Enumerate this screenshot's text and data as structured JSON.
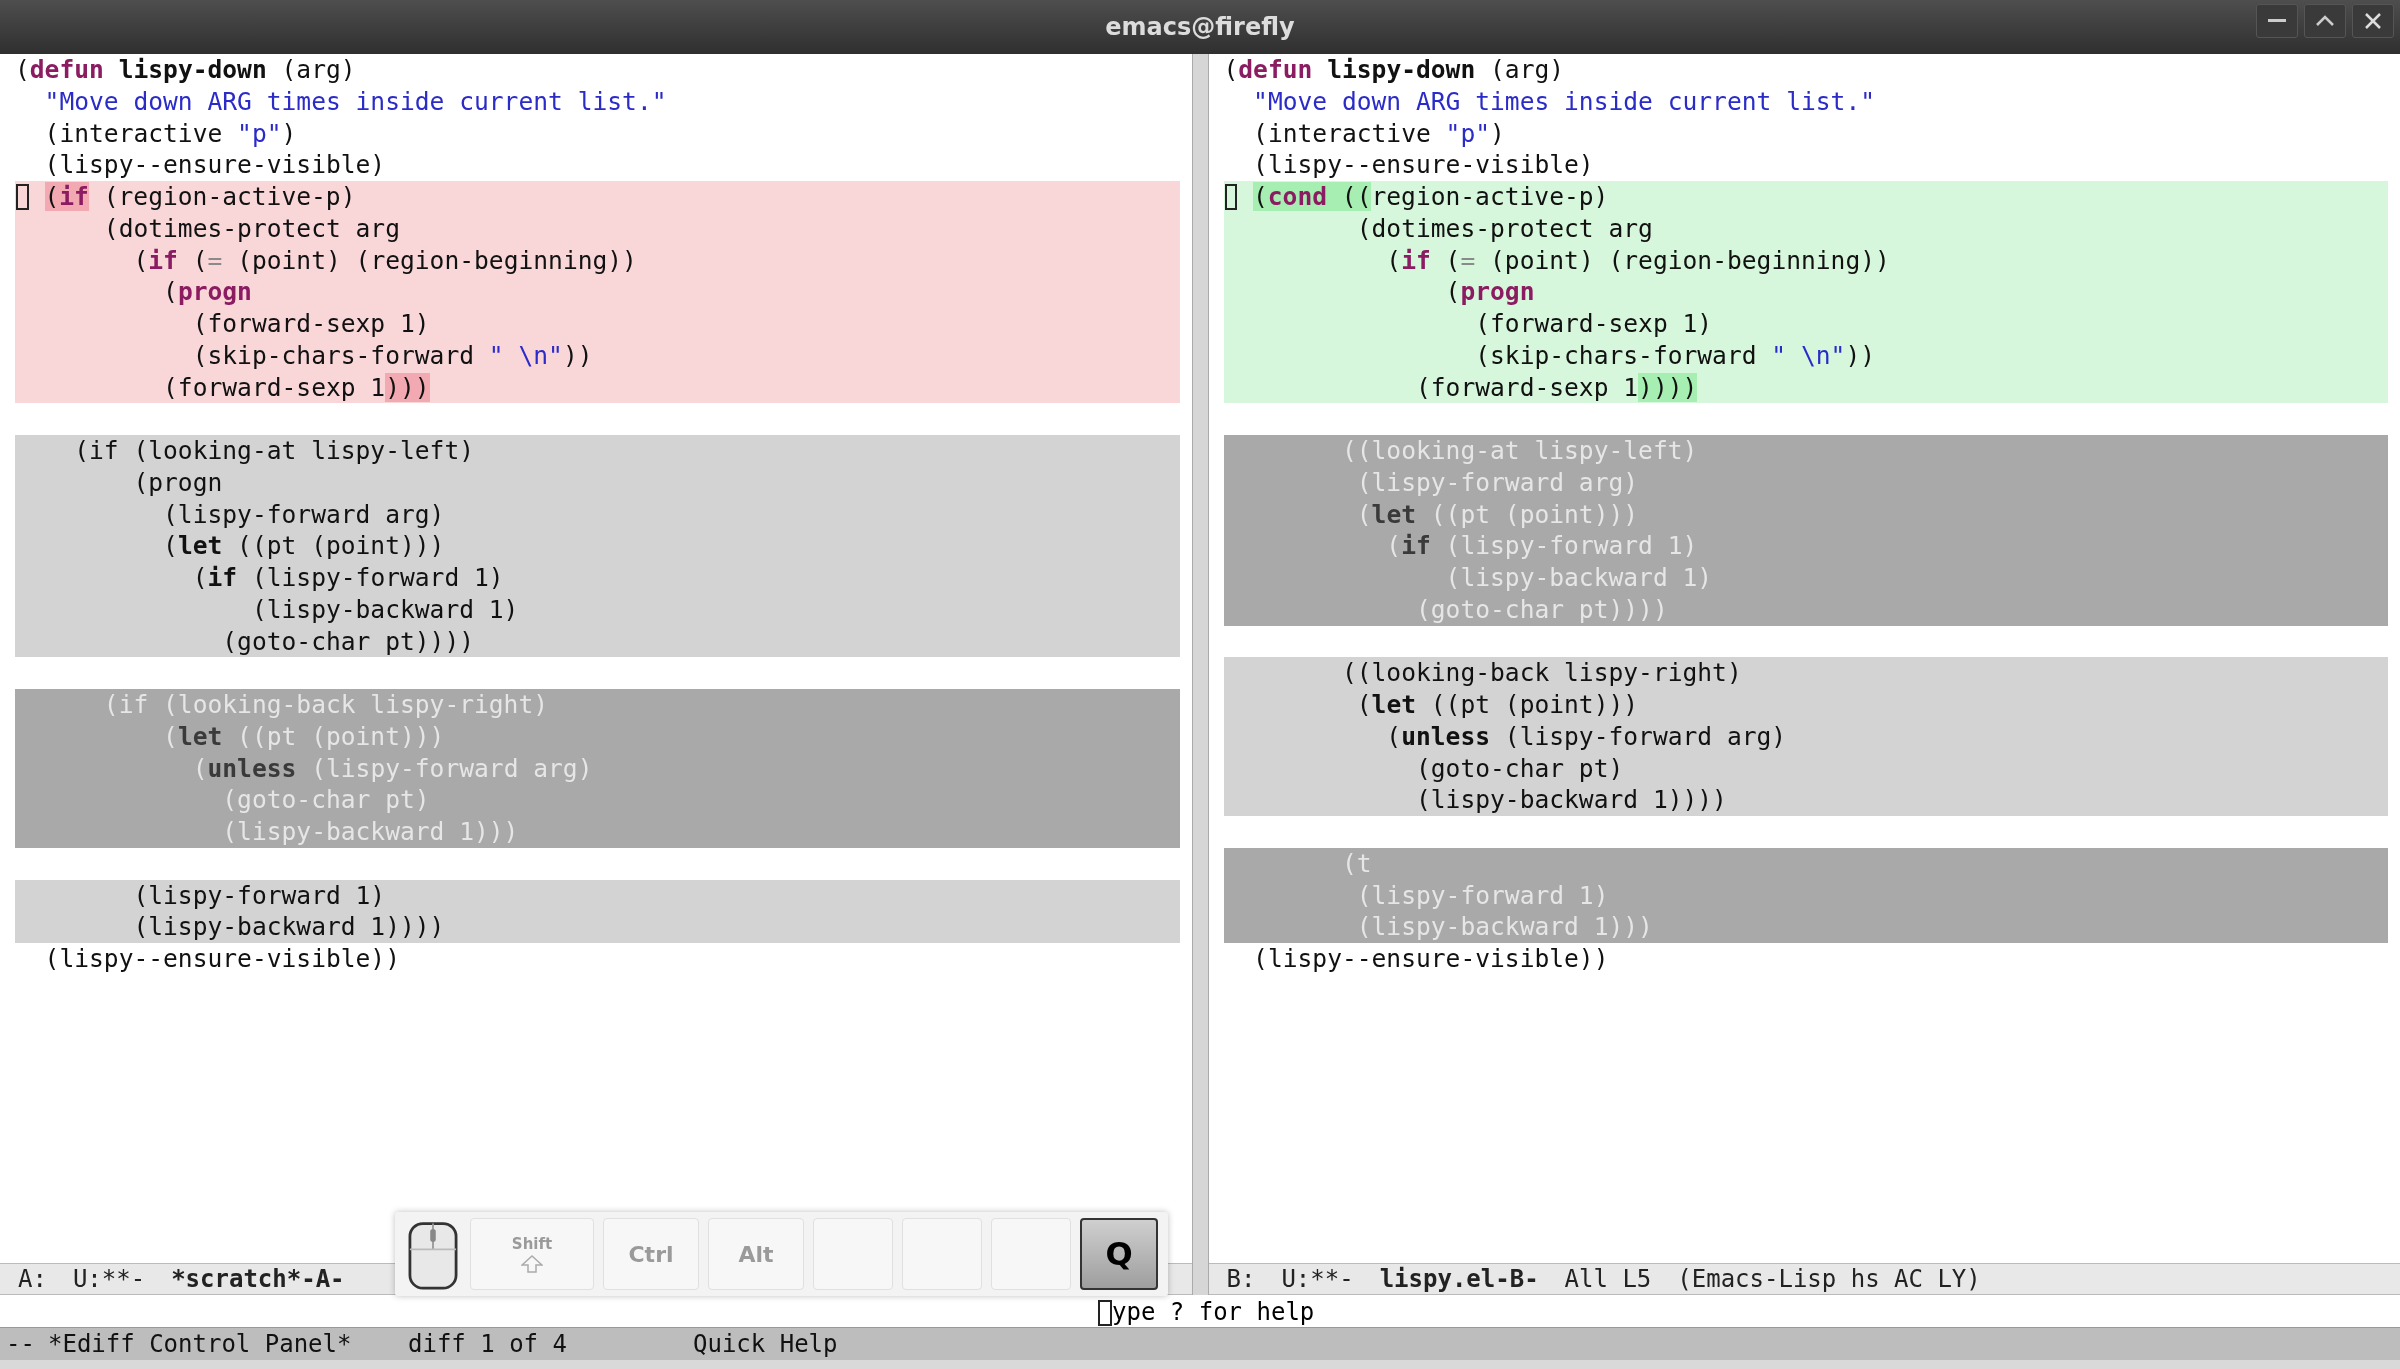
{
  "window": {
    "title": "emacs@firefly"
  },
  "panes": [
    {
      "blocks": [
        {
          "kind": "plain",
          "lines": [
            [
              {
                "text": "(",
                "kind": "plain"
              },
              {
                "text": "defun",
                "kind": "keyword"
              },
              {
                "text": " lispy-down",
                "kind": "bold"
              },
              {
                "text": " (arg)",
                "kind": "plain"
              }
            ],
            [
              {
                "text": "  \"Move down ARG times inside current list.\"",
                "kind": "string"
              }
            ],
            [
              {
                "text": "  (interactive ",
                "kind": "plain"
              },
              {
                "text": "\"p\"",
                "kind": "string"
              },
              {
                "text": ")",
                "kind": "plain"
              }
            ],
            [
              {
                "text": "  (lispy--ensure-visible)",
                "kind": "plain"
              }
            ]
          ]
        },
        {
          "kind": "removed",
          "lines": [
            {
              "cursor": true,
              "segs": [
                {
                  "text": "(",
                  "kind": "plain",
                  "hl": true
                },
                {
                  "text": "if",
                  "kind": "keyword",
                  "hl": true
                },
                {
                  "text": " (region-active-p)",
                  "kind": "plain"
                }
              ]
            },
            [
              {
                "text": "      (dotimes-protect arg",
                "kind": "plain"
              }
            ],
            [
              {
                "text": "        (",
                "kind": "plain"
              },
              {
                "text": "if",
                "kind": "keyword"
              },
              {
                "text": " (",
                "kind": "plain"
              },
              {
                "text": "=",
                "kind": "faint"
              },
              {
                "text": " (point) (region-beginning))",
                "kind": "plain"
              }
            ],
            [
              {
                "text": "          (",
                "kind": "plain"
              },
              {
                "text": "progn",
                "kind": "keyword"
              }
            ],
            [
              {
                "text": "            (forward-sexp 1)",
                "kind": "plain"
              }
            ],
            [
              {
                "text": "            (skip-chars-forward ",
                "kind": "plain"
              },
              {
                "text": "\" \\n\"",
                "kind": "string"
              },
              {
                "text": "))",
                "kind": "plain"
              }
            ],
            [
              {
                "text": "          (forward-sexp 1",
                "kind": "plain"
              },
              {
                "text": ")))",
                "kind": "plain",
                "hl": true
              }
            ]
          ]
        },
        {
          "kind": "blank"
        },
        {
          "kind": "diff-light",
          "lines": [
            [
              {
                "text": "    (if (looking-at lispy-left)",
                "kind": "plain"
              }
            ],
            [
              {
                "text": "        (progn",
                "kind": "plain"
              }
            ],
            [
              {
                "text": "          (lispy-forward arg)",
                "kind": "plain"
              }
            ],
            [
              {
                "text": "          (",
                "kind": "plain"
              },
              {
                "text": "let",
                "kind": "bold"
              },
              {
                "text": " ((pt (point)))",
                "kind": "plain"
              }
            ],
            [
              {
                "text": "            (",
                "kind": "plain"
              },
              {
                "text": "if",
                "kind": "bold"
              },
              {
                "text": " (lispy-forward 1)",
                "kind": "plain"
              }
            ],
            [
              {
                "text": "                (lispy-backward 1)",
                "kind": "plain"
              }
            ],
            [
              {
                "text": "              (goto-char pt))))",
                "kind": "plain"
              }
            ]
          ]
        },
        {
          "kind": "blank"
        },
        {
          "kind": "diff-dark",
          "lines": [
            [
              {
                "text": "      (if (looking-back lispy-right)",
                "kind": "plain"
              }
            ],
            [
              {
                "text": "          (",
                "kind": "plain"
              },
              {
                "text": "let",
                "kind": "bold"
              },
              {
                "text": " ((pt (point)))",
                "kind": "plain"
              }
            ],
            [
              {
                "text": "            (",
                "kind": "plain"
              },
              {
                "text": "unless",
                "kind": "bold"
              },
              {
                "text": " (lispy-forward arg)",
                "kind": "plain"
              }
            ],
            [
              {
                "text": "              (goto-char pt)",
                "kind": "plain"
              }
            ],
            [
              {
                "text": "              (lispy-backward 1)))",
                "kind": "plain"
              }
            ]
          ]
        },
        {
          "kind": "blank"
        },
        {
          "kind": "diff-light",
          "lines": [
            [
              {
                "text": "        (lispy-forward 1)",
                "kind": "plain"
              }
            ],
            [
              {
                "text": "        (lispy-backward 1))))",
                "kind": "plain"
              }
            ]
          ]
        },
        {
          "kind": "plain",
          "lines": [
            [
              {
                "text": "  (lispy--ensure-visible))",
                "kind": "plain"
              }
            ]
          ]
        }
      ],
      "mode_line": [
        {
          "text": "A:",
          "kind": "plain"
        },
        {
          "text": "U:**-",
          "kind": "plain"
        },
        {
          "text": "*scratch*-A-",
          "kind": "bold"
        }
      ]
    },
    {
      "blocks": [
        {
          "kind": "plain",
          "lines": [
            [
              {
                "text": "(",
                "kind": "plain"
              },
              {
                "text": "defun",
                "kind": "keyword"
              },
              {
                "text": " lispy-down",
                "kind": "bold"
              },
              {
                "text": " (arg)",
                "kind": "plain"
              }
            ],
            [
              {
                "text": "  \"Move down ARG times inside current list.\"",
                "kind": "string"
              }
            ],
            [
              {
                "text": "  (interactive ",
                "kind": "plain"
              },
              {
                "text": "\"p\"",
                "kind": "string"
              },
              {
                "text": ")",
                "kind": "plain"
              }
            ],
            [
              {
                "text": "  (lispy--ensure-visible)",
                "kind": "plain"
              }
            ]
          ]
        },
        {
          "kind": "added",
          "lines": [
            {
              "cursor": true,
              "segs": [
                {
                  "text": "(",
                  "kind": "plain",
                  "hl": true
                },
                {
                  "text": "cond",
                  "kind": "keyword",
                  "hl": true
                },
                {
                  "text": " ((",
                  "kind": "plain",
                  "hl": true
                },
                {
                  "text": "region-active-p)",
                  "kind": "plain"
                }
              ]
            },
            [
              {
                "text": "         (dotimes-protect arg",
                "kind": "plain"
              }
            ],
            [
              {
                "text": "           (",
                "kind": "plain"
              },
              {
                "text": "if",
                "kind": "keyword"
              },
              {
                "text": " (",
                "kind": "plain"
              },
              {
                "text": "=",
                "kind": "faint"
              },
              {
                "text": " (point) (region-beginning))",
                "kind": "plain"
              }
            ],
            [
              {
                "text": "               (",
                "kind": "plain"
              },
              {
                "text": "progn",
                "kind": "keyword"
              }
            ],
            [
              {
                "text": "                 (forward-sexp 1)",
                "kind": "plain"
              }
            ],
            [
              {
                "text": "                 (skip-chars-forward ",
                "kind": "plain"
              },
              {
                "text": "\" \\n\"",
                "kind": "string"
              },
              {
                "text": "))",
                "kind": "plain"
              }
            ],
            [
              {
                "text": "             (forward-sexp 1",
                "kind": "plain"
              },
              {
                "text": "))))",
                "kind": "plain",
                "hl": true
              }
            ]
          ]
        },
        {
          "kind": "blank"
        },
        {
          "kind": "diff-dark",
          "lines": [
            [
              {
                "text": "        ((looking-at lispy-left)",
                "kind": "plain"
              }
            ],
            [
              {
                "text": "         (lispy-forward arg)",
                "kind": "plain"
              }
            ],
            [
              {
                "text": "         (",
                "kind": "plain"
              },
              {
                "text": "let",
                "kind": "bold"
              },
              {
                "text": " ((pt (point)))",
                "kind": "plain"
              }
            ],
            [
              {
                "text": "           (",
                "kind": "plain"
              },
              {
                "text": "if",
                "kind": "bold"
              },
              {
                "text": " (lispy-forward 1)",
                "kind": "plain"
              }
            ],
            [
              {
                "text": "               (lispy-backward 1)",
                "kind": "plain"
              }
            ],
            [
              {
                "text": "             (goto-char pt))))",
                "kind": "plain"
              }
            ]
          ]
        },
        {
          "kind": "blank"
        },
        {
          "kind": "diff-light",
          "lines": [
            [
              {
                "text": "        ((looking-back lispy-right)",
                "kind": "plain"
              }
            ],
            [
              {
                "text": "         (",
                "kind": "plain"
              },
              {
                "text": "let",
                "kind": "bold"
              },
              {
                "text": " ((pt (point)))",
                "kind": "plain"
              }
            ],
            [
              {
                "text": "           (",
                "kind": "plain"
              },
              {
                "text": "unless",
                "kind": "bold"
              },
              {
                "text": " (lispy-forward arg)",
                "kind": "plain"
              }
            ],
            [
              {
                "text": "             (goto-char pt)",
                "kind": "plain"
              }
            ],
            [
              {
                "text": "             (lispy-backward 1))))",
                "kind": "plain"
              }
            ]
          ]
        },
        {
          "kind": "blank"
        },
        {
          "kind": "diff-dark",
          "lines": [
            [
              {
                "text": "        (t",
                "kind": "plain"
              }
            ],
            [
              {
                "text": "         (lispy-forward 1)",
                "kind": "plain"
              }
            ],
            [
              {
                "text": "         (lispy-backward 1)))",
                "kind": "plain"
              }
            ]
          ]
        },
        {
          "kind": "plain",
          "lines": [
            [
              {
                "text": "  (lispy--ensure-visible))",
                "kind": "plain"
              }
            ]
          ]
        }
      ],
      "mode_line": [
        {
          "text": "B:",
          "kind": "plain"
        },
        {
          "text": "U:**-",
          "kind": "plain"
        },
        {
          "text": "lispy.el-B-",
          "kind": "bold"
        },
        {
          "text": "All L5",
          "kind": "plain"
        },
        {
          "text": "(Emacs-Lisp hs AC LY)",
          "kind": "plain"
        }
      ]
    }
  ],
  "echo": {
    "text": "ype ? for help",
    "cursor": true
  },
  "control_mode_line": [
    "--",
    "*Ediff Control Panel*",
    "diff 1 of 4",
    "Quick Help"
  ],
  "keycast": [
    {
      "kind": "mouse"
    },
    {
      "kind": "shift",
      "label": "Shift",
      "pressed": false
    },
    {
      "kind": "key",
      "label": "Ctrl",
      "pressed": false
    },
    {
      "kind": "key",
      "label": "Alt",
      "pressed": false
    },
    {
      "kind": "key",
      "pressed": false
    },
    {
      "kind": "key",
      "pressed": false
    },
    {
      "kind": "key",
      "pressed": false
    },
    {
      "kind": "key",
      "label": "Q",
      "pressed": true
    }
  ]
}
